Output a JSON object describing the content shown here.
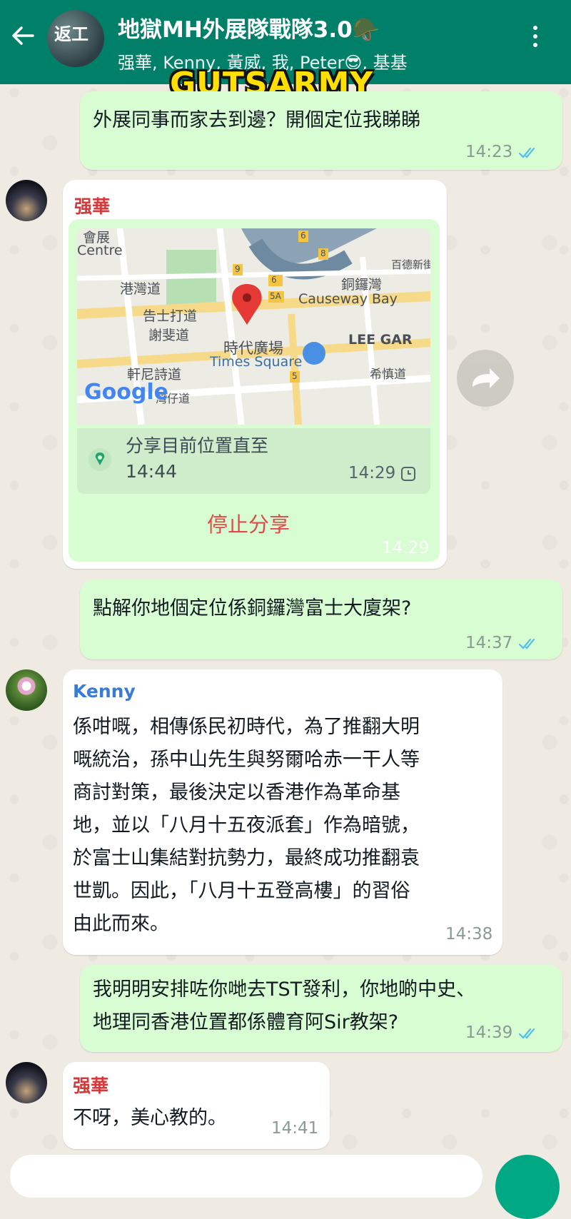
{
  "header": {
    "title": "地獄MH外展隊戰隊3.0🪖",
    "members": "强華, Kenny, 黃威, 我, Peter😎, 基基",
    "avatar_text": "返工",
    "watermark": "GUTSARMY"
  },
  "colors": {
    "header_bg": "#008069",
    "outgoing_bubble": "#d9fdd3",
    "incoming_bubble": "#ffffff",
    "sender_qianghua": "#d43a3a",
    "sender_kenny": "#3a7bd5",
    "read_ticks": "#53bdeb",
    "stop_share": "#e0494a"
  },
  "messages": [
    {
      "id": "m1",
      "direction": "out",
      "text": "外展同事而家去到邊？開個定位我睇睇",
      "time": "14:23",
      "status": "read"
    },
    {
      "id": "m2",
      "direction": "in",
      "sender": "强華",
      "type": "live_location",
      "map_labels": {
        "centre_cn": "會展",
        "centre_en": "Centre",
        "harbour_rd": "港灣道",
        "gloucester_rd": "告士打道",
        "jaffe_rd": "謝斐道",
        "times_cn": "時代廣場",
        "times_en": "Times Square",
        "cwb_cn": "銅鑼灣",
        "cwb_en": "Causeway Bay",
        "lee_gar": "LEE GAR",
        "hennessy": "軒尼詩道",
        "wan_chai": "灣仔道",
        "hysan": "希慎道",
        "baishunxin": "百德新街",
        "google": "Google",
        "route_9": "9",
        "route_6": "6",
        "route_8": "8",
        "route_5a": "5A",
        "route_5": "5",
        "route_6b": "6"
      },
      "share_label": "分享目前位置直至",
      "share_until": "14:44",
      "share_time": "14:29",
      "stop_label": "停止分享",
      "time": "14:29"
    },
    {
      "id": "m3",
      "direction": "out",
      "text": "點解你地個定位係銅鑼灣富士大廈架?",
      "time": "14:37",
      "status": "read"
    },
    {
      "id": "m4",
      "direction": "in",
      "sender": "Kenny",
      "lines": [
        "係咁嘅，相傳係民初時代，為了推翻大明",
        "嘅統治，孫中山先生與努爾哈赤一干人等",
        "商討對策，最後決定以香港作為革命基",
        "地，並以「八月十五夜派套」作為暗號，",
        "於富士山集結對抗勢力，最終成功推翻袁",
        "世凱。因此，「八月十五登高樓」的習俗",
        "由此而來。"
      ],
      "time": "14:38"
    },
    {
      "id": "m5",
      "direction": "out",
      "lines": [
        "我明明安排咗你哋去TST發利，你地啲中史、",
        "地理同香港位置都係體育阿Sir教架?"
      ],
      "time": "14:39",
      "status": "read"
    },
    {
      "id": "m6",
      "direction": "in",
      "sender": "强華",
      "text": "不呀，美心教的。",
      "time": "14:41"
    }
  ]
}
